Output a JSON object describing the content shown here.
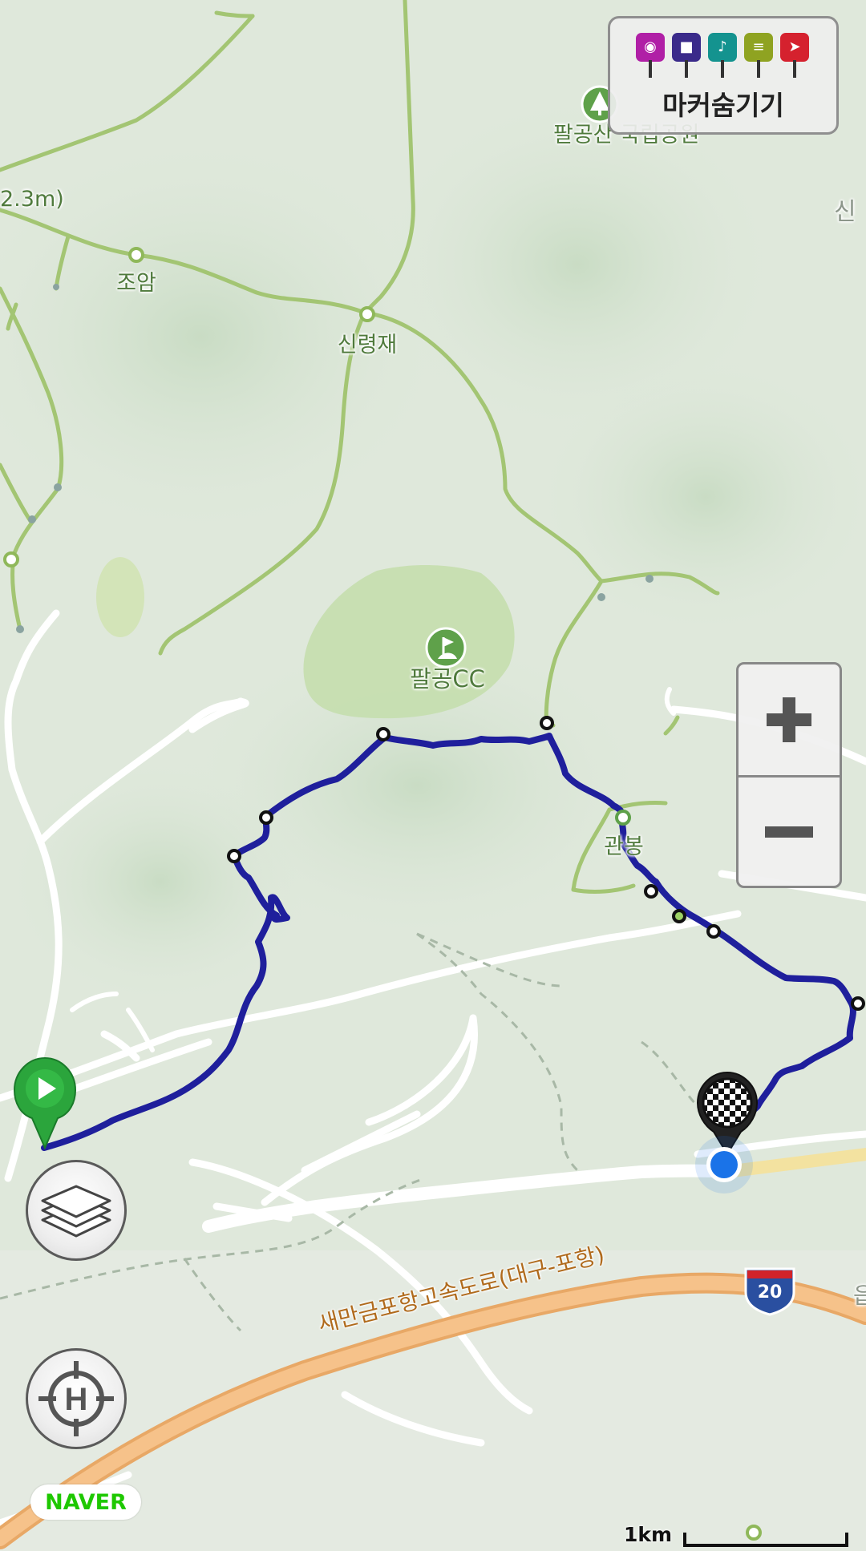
{
  "marker_toggle": {
    "label": "마커숨기기",
    "markers": [
      {
        "name": "camera",
        "icon": "camera-icon",
        "glyph": "◉",
        "color": "#b01fa6"
      },
      {
        "name": "video",
        "icon": "video-icon",
        "glyph": "■",
        "color": "#3a2a8a"
      },
      {
        "name": "audio",
        "icon": "microphone-icon",
        "glyph": "♪",
        "color": "#14938f"
      },
      {
        "name": "memo",
        "icon": "memo-icon",
        "glyph": "≡",
        "color": "#8fa321"
      },
      {
        "name": "flag",
        "icon": "flag-icon",
        "glyph": "➤",
        "color": "#d5212e"
      }
    ]
  },
  "map": {
    "provider_logo": "NAVER",
    "labels": {
      "park": "팔공산 국립공원",
      "golf": "팔공CC",
      "pass": "신령재",
      "rock": "조암",
      "peak": "관봉",
      "elevation": "2.3m)",
      "edge_right": "신",
      "edge_bottom": "읍"
    },
    "highway_name": "새만금포항고속도로(대구-포항)",
    "highway_shield": "20",
    "colors": {
      "track": "#1f1f9c",
      "trail": "#9bbf6a",
      "highway": "#f2b97a",
      "route_highlight": "#f4e3a0",
      "location": "#1a73e8",
      "start": "#2ba53c"
    }
  },
  "controls": {
    "zoom_in": "+",
    "zoom_out": "−",
    "layers": "layers",
    "current_location": "H"
  },
  "scale": {
    "label": "1km"
  }
}
